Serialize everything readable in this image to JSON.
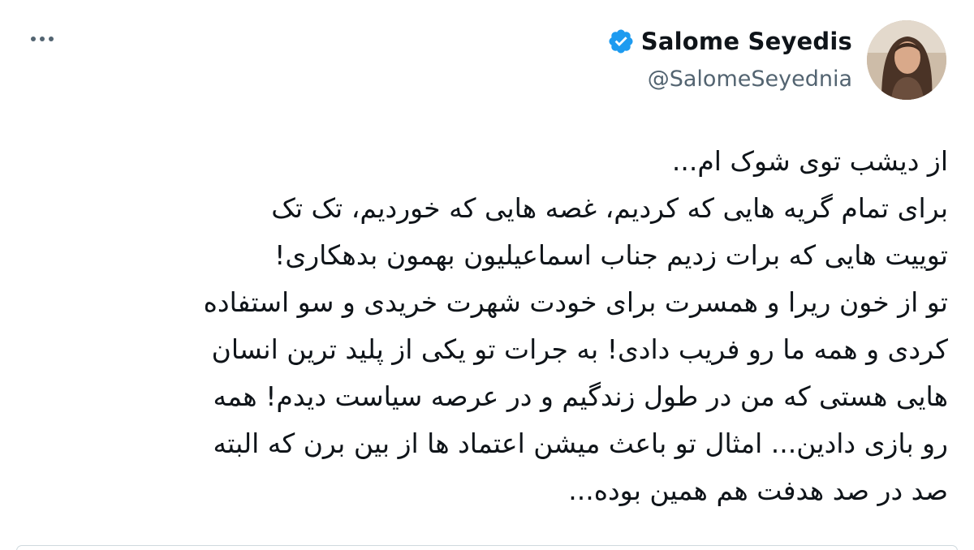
{
  "author": {
    "display_name": "Salome Seyedis",
    "handle": "@SalomeSeyednia",
    "verified": true,
    "verified_color": "#1d9bf0",
    "avatar_icon": "profile-photo"
  },
  "more_icon": "more-horizontal-icon",
  "tweet": {
    "lines": [
      "از دیشب توی شوک ام...",
      "برای تمام گریه هایی که کردیم، غصه هایی که خوردیم، تک تک",
      "توییت هایی که برات زدیم جناب اسماعیلیون بهمون بدهکاری!",
      "تو از خون ریرا و همسرت برای خودت شهرت خریدی و سو استفاده",
      "کردی و همه ما رو فریب دادی! به جرات تو یکی از پلید ترین انسان",
      "هایی هستی که من در طول زندگیم و در عرصه سیاست دیدم! همه",
      "رو بازی دادین... امثال تو باعث میشن اعتماد ها از بین برن که البته",
      "صد در صد هدفت هم همین بوده..."
    ]
  }
}
